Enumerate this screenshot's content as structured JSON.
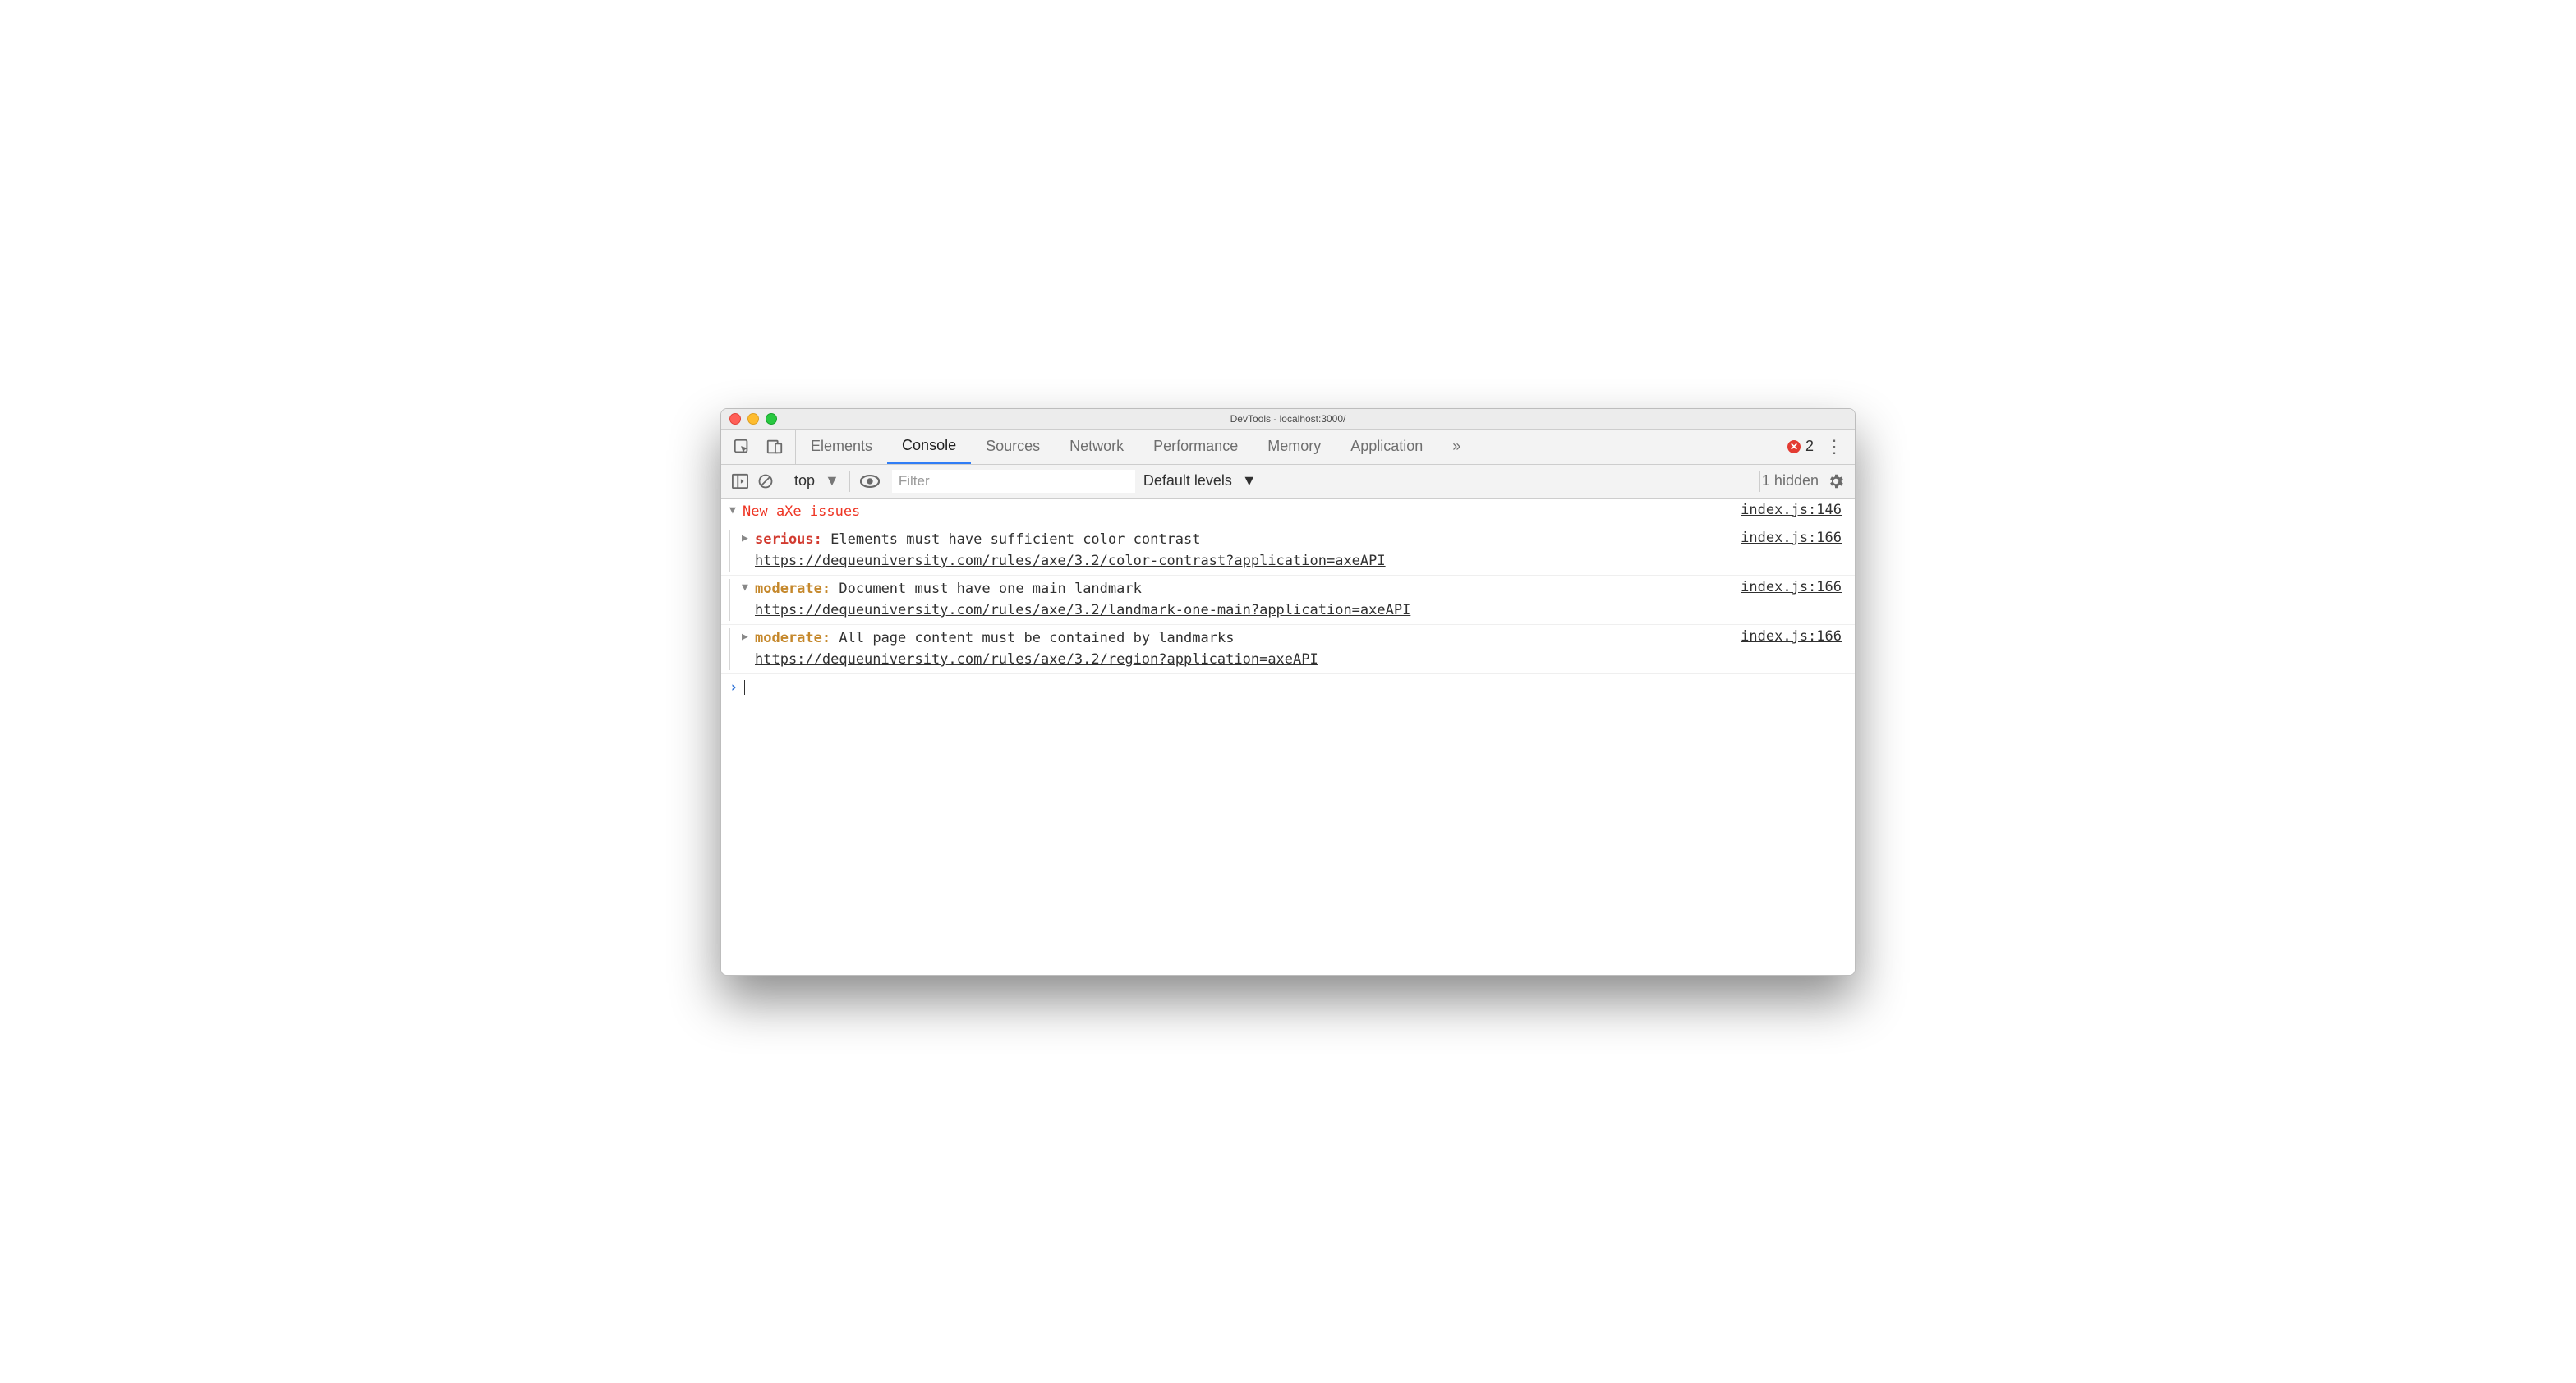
{
  "window": {
    "title": "DevTools - localhost:3000/"
  },
  "tabs": {
    "items": [
      "Elements",
      "Console",
      "Sources",
      "Network",
      "Performance",
      "Memory",
      "Application"
    ],
    "active": "Console"
  },
  "errors": {
    "count": "2"
  },
  "console_toolbar": {
    "context": "top",
    "filter_placeholder": "Filter",
    "levels_label": "Default levels",
    "hidden_label": "1 hidden"
  },
  "console": {
    "group": {
      "title": "New aXe issues",
      "source": "index.js:146"
    },
    "messages": [
      {
        "expanded": false,
        "severity": "serious",
        "text": "Elements must have sufficient color contrast",
        "url": "https://dequeuniversity.com/rules/axe/3.2/color-contrast?application=axeAPI",
        "source": "index.js:166"
      },
      {
        "expanded": true,
        "severity": "moderate",
        "text": "Document must have one main landmark",
        "url": "https://dequeuniversity.com/rules/axe/3.2/landmark-one-main?application=axeAPI",
        "source": "index.js:166"
      },
      {
        "expanded": false,
        "severity": "moderate",
        "text": "All page content must be contained by landmarks",
        "url": "https://dequeuniversity.com/rules/axe/3.2/region?application=axeAPI",
        "source": "index.js:166"
      }
    ]
  }
}
